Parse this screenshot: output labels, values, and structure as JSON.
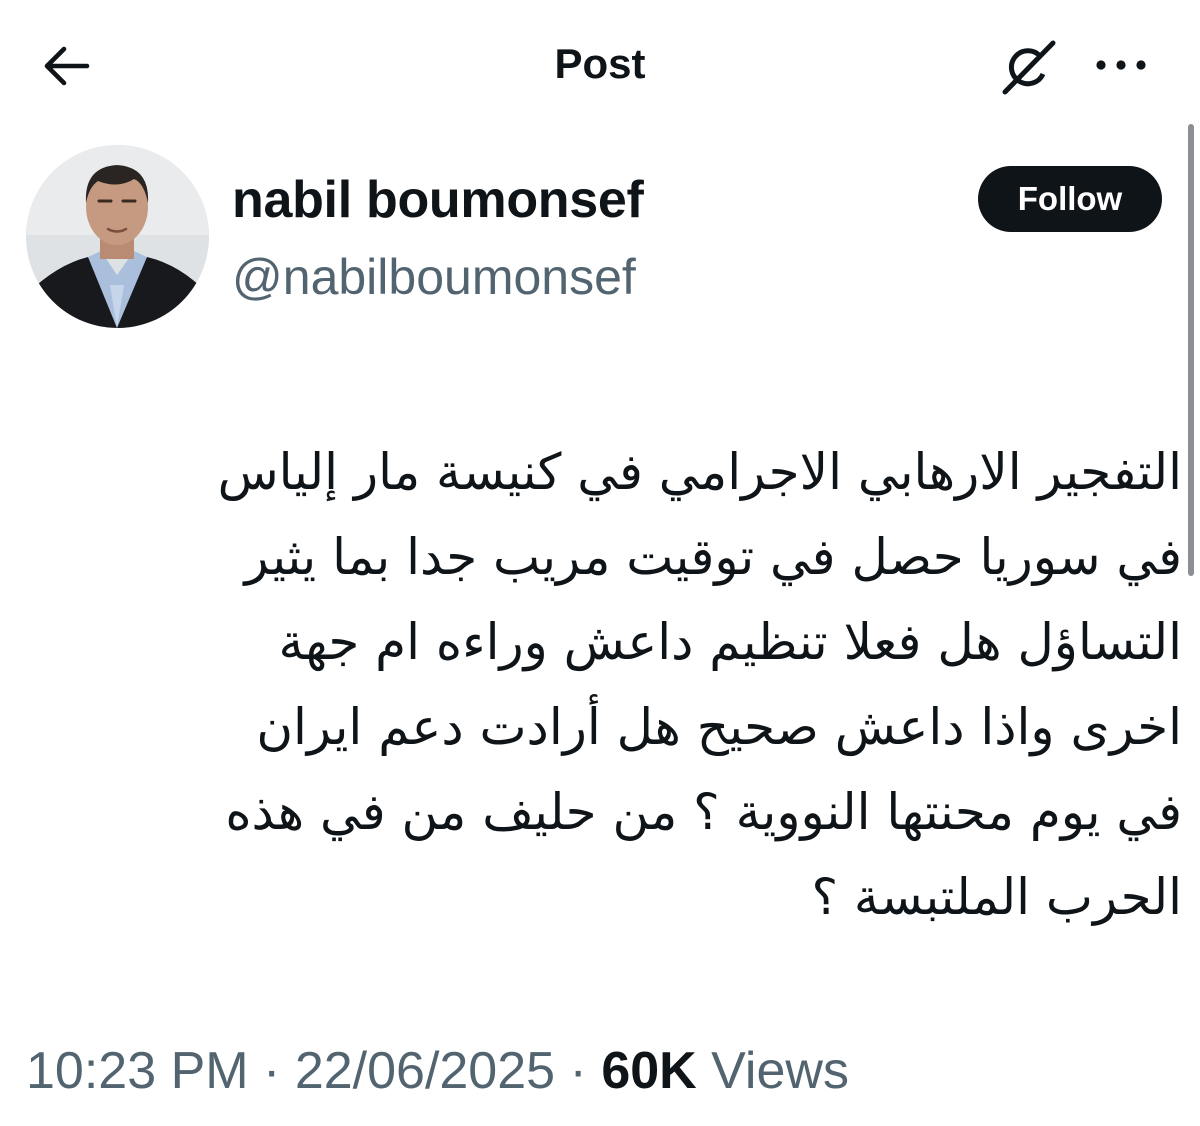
{
  "header": {
    "title": "Post",
    "back_icon": "arrow-left-icon",
    "grok_icon": "grok-icon",
    "more_icon": "more-horizontal-icon"
  },
  "author": {
    "display_name": "nabil boumonsef",
    "handle": "@nabilboumonsef",
    "follow_label": "Follow"
  },
  "tweet": {
    "lines": [
      "التفجير الارهابي الاجرامي في كنيسة مار إلياس",
      "في سوريا حصل في توقيت مريب جدا بما يثير",
      "التساؤل هل فعلا تنظيم داعش وراءه ام جهة",
      "اخرى واذا داعش صحيح هل أرادت دعم ايران",
      "في يوم محنتها النووية ؟ من حليف من في هذه",
      "الحرب الملتبسة ؟"
    ]
  },
  "meta": {
    "time": "10:23 PM",
    "separator": "·",
    "date": "22/06/2025",
    "views_count": "60K",
    "views_label": "Views"
  },
  "colors": {
    "text_primary": "#0f1419",
    "text_secondary": "#536471",
    "follow_bg": "#0f1419",
    "follow_text": "#ffffff"
  }
}
